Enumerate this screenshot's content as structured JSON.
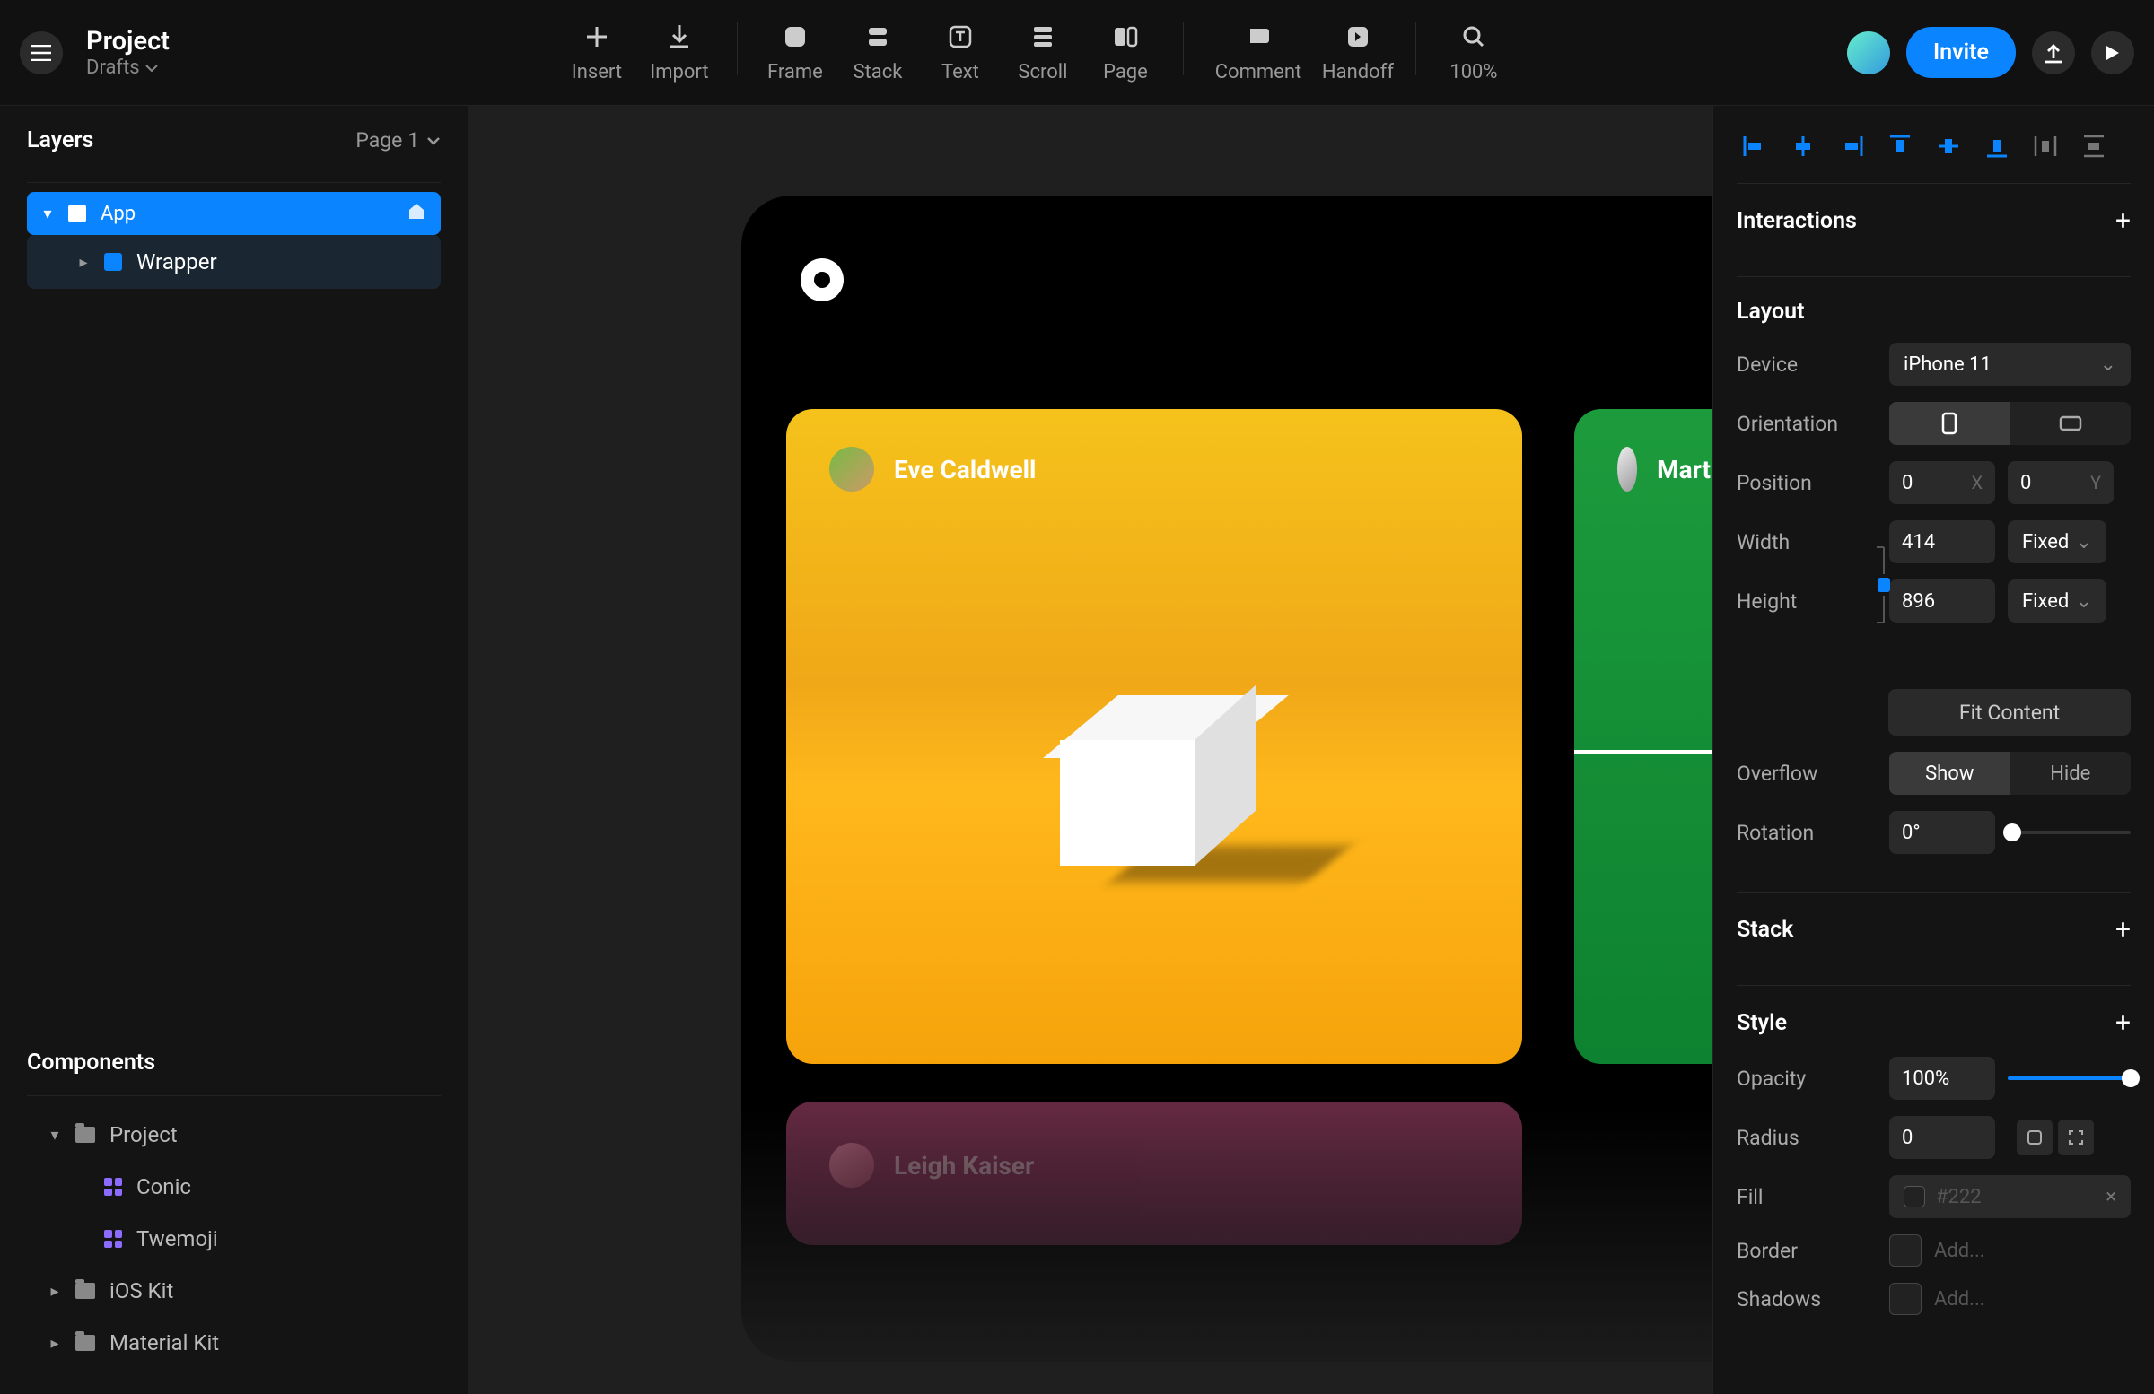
{
  "header": {
    "project_title": "Project",
    "drafts_label": "Drafts",
    "tools": {
      "insert": "Insert",
      "import": "Import",
      "frame": "Frame",
      "stack": "Stack",
      "text": "Text",
      "scroll": "Scroll",
      "page": "Page",
      "comment": "Comment",
      "handoff": "Handoff"
    },
    "zoom": "100%",
    "invite_label": "Invite"
  },
  "left": {
    "layers_title": "Layers",
    "page_selector": "Page 1",
    "layer_app": "App",
    "layer_wrapper": "Wrapper",
    "components_title": "Components",
    "comp_project": "Project",
    "comp_conic": "Conic",
    "comp_twemoji": "Twemoji",
    "comp_ios": "iOS Kit",
    "comp_material": "Material Kit"
  },
  "canvas": {
    "card1_name": "Eve Caldwell",
    "card2_name": "Mart",
    "card3_name": "Leigh Kaiser"
  },
  "right": {
    "interactions_title": "Interactions",
    "layout_title": "Layout",
    "device_label": "Device",
    "device_value": "iPhone 11",
    "orientation_label": "Orientation",
    "position_label": "Position",
    "pos_x": "0",
    "pos_y": "0",
    "pos_x_unit": "X",
    "pos_y_unit": "Y",
    "width_label": "Width",
    "width_value": "414",
    "width_mode": "Fixed",
    "height_label": "Height",
    "height_value": "896",
    "height_mode": "Fixed",
    "fit_content": "Fit Content",
    "overflow_label": "Overflow",
    "overflow_show": "Show",
    "overflow_hide": "Hide",
    "rotation_label": "Rotation",
    "rotation_value": "0°",
    "stack_title": "Stack",
    "style_title": "Style",
    "opacity_label": "Opacity",
    "opacity_value": "100%",
    "radius_label": "Radius",
    "radius_value": "0",
    "fill_label": "Fill",
    "fill_value": "#222",
    "border_label": "Border",
    "shadows_label": "Shadows",
    "add_label": "Add..."
  }
}
